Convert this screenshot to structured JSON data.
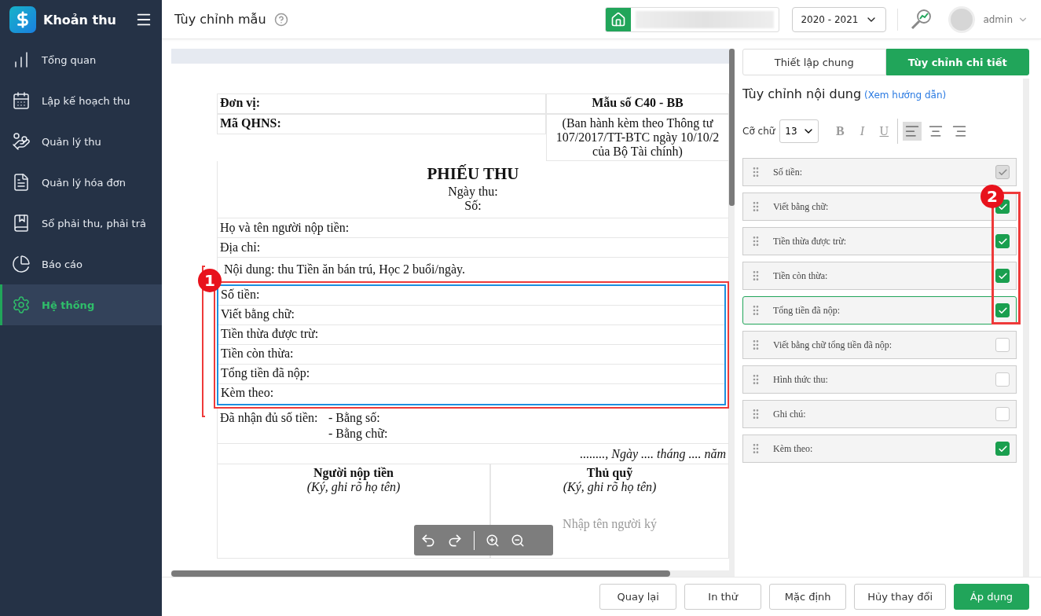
{
  "app": {
    "title": "Khoản thu"
  },
  "sidebar": {
    "items": [
      {
        "label": "Tổng quan",
        "selected": false
      },
      {
        "label": "Lập kế hoạch thu",
        "selected": false
      },
      {
        "label": "Quản lý thu",
        "selected": false
      },
      {
        "label": "Quản lý hóa đơn",
        "selected": false
      },
      {
        "label": "Sổ phải thu, phải trả",
        "selected": false
      },
      {
        "label": "Báo cáo",
        "selected": false
      },
      {
        "label": "Hệ thống",
        "selected": true
      }
    ]
  },
  "header": {
    "title": "Tùy chỉnh mẫu",
    "year": "2020 - 2021",
    "user": "admin"
  },
  "document": {
    "unit_label": "Đơn vị:",
    "code_label": "Mã QHNS:",
    "form_no": "Mẫu số C40 - BB",
    "form_note": [
      "(Ban hành kèm theo Thông tư",
      "107/2017/TT-BTC ngày 10/10/2",
      "của Bộ Tài chính)"
    ],
    "title": "PHIẾU THU",
    "title_lines": [
      "Ngày thu:",
      "Số:"
    ],
    "info_rows": [
      "Họ và tên người nộp tiền:",
      "Địa chỉ:",
      "Nội dung: thu  Tiền ăn bán trú, Học 2 buổi/ngày."
    ],
    "selected_rows": [
      "Số tiền:",
      "Viết bằng chữ:",
      "Tiền thừa được trừ:",
      "Tiền còn thừa:",
      "Tổng tiền đã nộp:",
      "Kèm theo:"
    ],
    "received": {
      "label": "Đã nhận đủ số tiền:",
      "lines": [
        "- Bằng số:",
        "- Bằng chữ:"
      ]
    },
    "date_line": "........, Ngày .... tháng .... năm",
    "signers": [
      {
        "title": "Người nộp tiền",
        "note": "(Ký, ghi rõ họ tên)"
      },
      {
        "title": "Thủ quỹ",
        "note": "(Ký, ghi rõ họ tên)",
        "placeholder": "Nhập tên người ký"
      }
    ]
  },
  "tabs": [
    {
      "label": "Thiết lập chung",
      "selected": false
    },
    {
      "label": "Tùy chỉnh chi tiết",
      "selected": true
    }
  ],
  "panel": {
    "heading": "Tùy chỉnh nội dung",
    "link": "(Xem hướng dẫn)",
    "font_size_label": "Cỡ chữ",
    "font_size": "13",
    "formats": [
      {
        "label": "B",
        "kind": "bold"
      },
      {
        "label": "I",
        "kind": "italic"
      },
      {
        "label": "U",
        "kind": "underline"
      }
    ],
    "align": [
      {
        "kind": "left",
        "selected": true
      },
      {
        "kind": "center",
        "selected": false
      },
      {
        "kind": "right",
        "selected": false
      }
    ],
    "fields": [
      {
        "label": "Số tiền:",
        "checked": true,
        "disabled": true,
        "selected": false
      },
      {
        "label": "Viết bằng chữ:",
        "checked": true,
        "disabled": false,
        "selected": false
      },
      {
        "label": "Tiền thừa được trừ:",
        "checked": true,
        "disabled": false,
        "selected": false
      },
      {
        "label": "Tiền còn thừa:",
        "checked": true,
        "disabled": false,
        "selected": false
      },
      {
        "label": "Tổng tiền đã nộp:",
        "checked": true,
        "disabled": false,
        "selected": true
      },
      {
        "label": "Viết bằng chữ tổng tiền đã nộp:",
        "checked": false,
        "disabled": false,
        "selected": false
      },
      {
        "label": "Hình thức thu:",
        "checked": false,
        "disabled": false,
        "selected": false
      },
      {
        "label": "Ghi chú:",
        "checked": false,
        "disabled": false,
        "selected": false
      },
      {
        "label": "Kèm theo:",
        "checked": true,
        "disabled": false,
        "selected": false
      }
    ]
  },
  "callouts": [
    {
      "label": "1"
    },
    {
      "label": "2"
    }
  ],
  "buttons": [
    {
      "label": "Quay lại",
      "kind": "default"
    },
    {
      "label": "In thử",
      "kind": "default"
    },
    {
      "label": "Mặc định",
      "kind": "default"
    },
    {
      "label": "Hủy thay đổi",
      "kind": "default"
    },
    {
      "label": "Áp dụng",
      "kind": "primary"
    }
  ]
}
